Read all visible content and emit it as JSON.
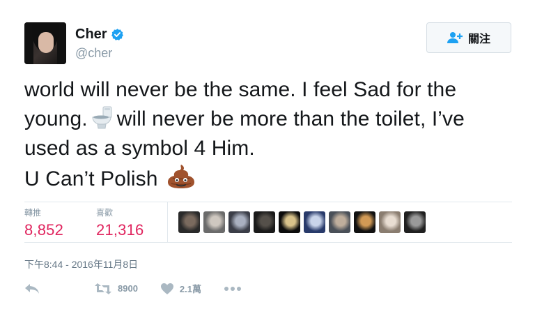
{
  "author": {
    "display_name": "Cher",
    "handle": "@cher",
    "verified_icon": "verified-badge-icon"
  },
  "follow_button": {
    "label": "關注",
    "icon": "add-user-icon"
  },
  "tweet": {
    "line1": "world will never be the same. I feel Sad for the",
    "line2_before": "young.",
    "line2_emoji": "toilet-emoji-icon",
    "line2_after": "will never be more than the toilet, I’ve",
    "line3": "used as a symbol 4 Him.",
    "line4": "U Can’t Polish",
    "line4_emoji": "pile-of-poo-emoji-icon"
  },
  "stats": {
    "retweets_label": "轉推",
    "retweets_value": "8,852",
    "likes_label": "喜歡",
    "likes_value": "21,316"
  },
  "likers": [
    {
      "colors": [
        "#2a2a2a",
        "#7a6a5e"
      ]
    },
    {
      "colors": [
        "#6b6b6b",
        "#cfc8c0"
      ]
    },
    {
      "colors": [
        "#3b3e48",
        "#a9b0c0"
      ]
    },
    {
      "colors": [
        "#1a1a1a",
        "#55504a"
      ]
    },
    {
      "colors": [
        "#0c0c0c",
        "#d8c28a"
      ]
    },
    {
      "colors": [
        "#283a6a",
        "#c9d4ea"
      ]
    },
    {
      "colors": [
        "#4a5058",
        "#bfae9c"
      ]
    },
    {
      "colors": [
        "#111111",
        "#d29a55"
      ]
    },
    {
      "colors": [
        "#8a7d70",
        "#e8ddd2"
      ]
    },
    {
      "colors": [
        "#202020",
        "#9a9a9a"
      ]
    }
  ],
  "timestamp": "下午8:44 - 2016年11月8日",
  "actions": {
    "reply_icon": "reply-icon",
    "retweet_icon": "retweet-icon",
    "retweet_count": "8900",
    "like_icon": "heart-icon",
    "like_count": "2.1萬",
    "more_icon": "more-dots-icon"
  },
  "colors": {
    "text": "#14171a",
    "muted": "#8899a6",
    "accent_red": "#e0245e",
    "verified_blue": "#1da1f2",
    "divider": "#e1e8ed"
  }
}
